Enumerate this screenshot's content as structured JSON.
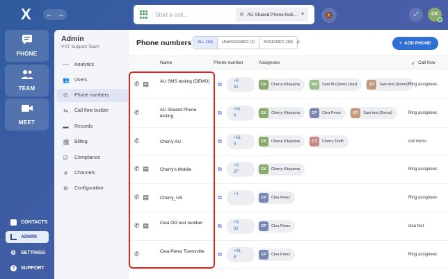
{
  "rail": {
    "logo": "X",
    "phone": "PHONE",
    "team": "TEAM",
    "meet": "MEET",
    "contacts": "CONTACTS",
    "admin": "ADMIN",
    "settings": "SETTINGS",
    "support": "SUPPORT"
  },
  "topbar": {
    "placeholder": "Start a call...",
    "line": "AU Shared Phone testi...",
    "user_initials": "CK"
  },
  "admin": {
    "title": "Admin",
    "subtitle": "VXT Support Team",
    "items": [
      "Analytics",
      "Users",
      "Phone numbers",
      "Call flow builder",
      "Records",
      "Billing",
      "Compliance",
      "Channels",
      "Configuration"
    ]
  },
  "main": {
    "title": "Phone numbers",
    "tabs": [
      "ALL (19)",
      "UNASSIGNED (1)",
      "ASSIGNED (18)"
    ],
    "add_button": "ADD PHONE",
    "headers": {
      "name": "Name",
      "number": "Phone number",
      "assignees": "Assignees",
      "flow": "Call flow"
    },
    "rows": [
      {
        "name": "AU SMS testing (DEMO)",
        "num1": "+6",
        "num2": "91",
        "flow": "Ring assignees",
        "assignees": [
          {
            "i": "CK",
            "n": "Cherry Kitayama",
            "c": "#8aa96a"
          },
          {
            "i": "SM",
            "n": "Sam M (Demo User)",
            "c": "#9bbf8a"
          },
          {
            "i": "ST",
            "n": "Sam test (Demo)",
            "c": "#c09a7a"
          }
        ]
      },
      {
        "name": "AU Shared Phone testing",
        "num1": "+61",
        "num2": "0",
        "flow": "Ring assignees",
        "assignees": [
          {
            "i": "CK",
            "n": "Cherry Kitayama",
            "c": "#8aa96a"
          },
          {
            "i": "CP",
            "n": "Clea Perez",
            "c": "#7b86b0"
          },
          {
            "i": "ST",
            "n": "Sam test (Demo)",
            "c": "#c09a7a"
          }
        ]
      },
      {
        "name": "Cherry AU",
        "num1": "+61",
        "num2": "4",
        "flow": "call menu",
        "assignees": [
          {
            "i": "CK",
            "n": "Cherry Kitayama",
            "c": "#8aa96a"
          },
          {
            "i": "CT",
            "n": "Cherry Test5",
            "c": "#c78a84"
          }
        ]
      },
      {
        "name": "Cherry's Mobile",
        "num1": "+6",
        "num2": "27",
        "flow": "Ring assignees",
        "assignees": [
          {
            "i": "CK",
            "n": "Cherry Kitayama",
            "c": "#8aa96a"
          }
        ]
      },
      {
        "name": "Cherry_US",
        "num1": "+1",
        "num2": "",
        "flow": "Ring assignees",
        "assignees": [
          {
            "i": "CP",
            "n": "Clea Perez",
            "c": "#7b86b0"
          }
        ]
      },
      {
        "name": "Clea OG test number",
        "num1": "+6",
        "num2": "91",
        "flow": "clea test",
        "assignees": [
          {
            "i": "CP",
            "n": "Clea Perez",
            "c": "#7b86b0"
          }
        ]
      },
      {
        "name": "Clea Perez Townsville",
        "num1": "+61",
        "num2": "8",
        "flow": "Ring assignees",
        "assignees": [
          {
            "i": "CP",
            "n": "Clea Perez",
            "c": "#7b86b0"
          }
        ]
      }
    ]
  }
}
